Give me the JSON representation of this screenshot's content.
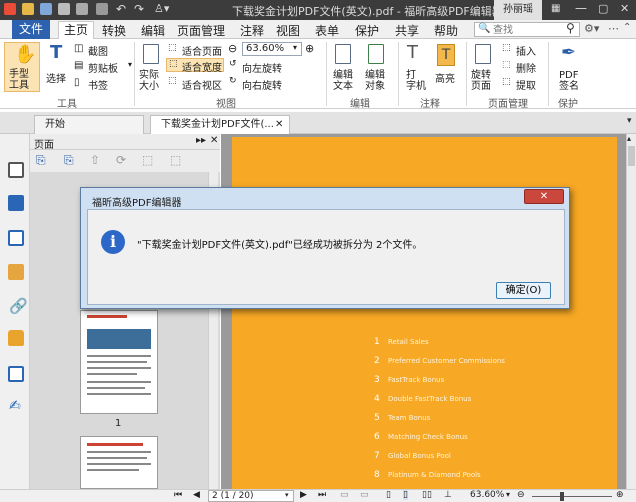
{
  "titlebar": {
    "title": "下载奖金计划PDF文件(英文).pdf - 福昕高级PDF编辑器",
    "user": "孙丽瑶"
  },
  "menu": {
    "file": "文件",
    "items": [
      "主页",
      "转换",
      "编辑",
      "页面管理",
      "注释",
      "视图",
      "表单",
      "保护",
      "共享",
      "帮助"
    ]
  },
  "search": {
    "placeholder": "查找"
  },
  "ribbon": {
    "hand": "手型\n工具",
    "select": "选择",
    "screenshot": "截图",
    "clipboard": "剪贴板",
    "bookmark": "书签",
    "actual_size": "实际\n大小",
    "fit_page": "适合页面",
    "fit_width": "适合宽度",
    "fit_view": "适合视区",
    "zoom_value": "63.60%",
    "rotate_left": "向左旋转",
    "rotate_right": "向右旋转",
    "edit_text": "编辑\n文本",
    "edit_object": "编辑\n对象",
    "typewriter": "打\n字机",
    "highlight": "高亮",
    "rotate_page": "旋转\n页面",
    "insert": "插入",
    "delete": "删除",
    "extract": "提取",
    "pdf_sign": "PDF\n签名",
    "groups": {
      "tools": "工具",
      "view": "视图",
      "edit": "编辑",
      "comment": "注释",
      "page_manage": "页面管理",
      "protect": "保护"
    }
  },
  "tabs": {
    "start": "开始",
    "doc": "下载奖金计划PDF文件(..."
  },
  "pages_panel": {
    "title": "页面",
    "page_label": "1"
  },
  "dialog": {
    "title": "福昕高级PDF编辑器",
    "message": "\"下载奖金计划PDF文件(英文).pdf\"已经成功被拆分为 2个文件。",
    "ok": "确定(O)"
  },
  "document_list": [
    {
      "n": "1",
      "text": "Retail Sales"
    },
    {
      "n": "2",
      "text": "Preferred Customer Commissions"
    },
    {
      "n": "3",
      "text": "FastTrack Bonus"
    },
    {
      "n": "4",
      "text": "Double FastTrack Bonus"
    },
    {
      "n": "5",
      "text": "Team Bonus"
    },
    {
      "n": "6",
      "text": "Matching Check Bonus"
    },
    {
      "n": "7",
      "text": "Global Bonus Pool"
    },
    {
      "n": "8",
      "text": "Platinum & Diamond Pools"
    }
  ],
  "status": {
    "page": "2 (1 / 20)",
    "zoom": "63.60%"
  },
  "colors": {
    "accent": "#2c62b0",
    "page": "#f7a824",
    "dialog_frame": "#cfe0f2"
  }
}
